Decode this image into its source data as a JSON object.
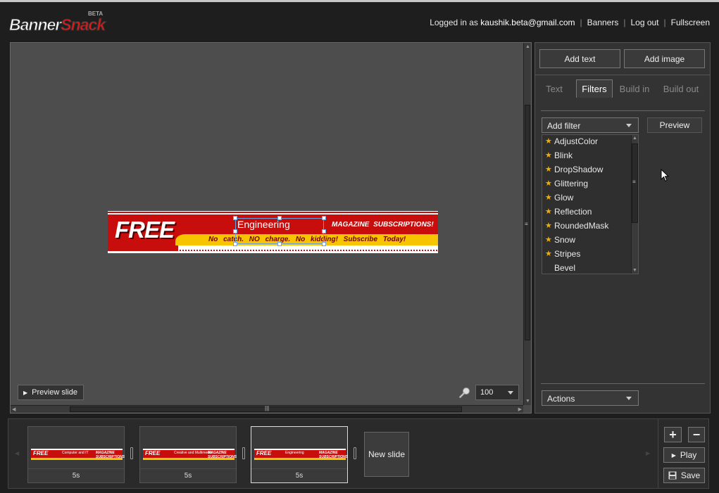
{
  "header": {
    "logo": {
      "part1": "Banner",
      "part2": "Snack",
      "beta": "BETA"
    },
    "logged_prefix": "Logged in as",
    "user_email": "kaushik.beta@gmail.com",
    "links": [
      "Banners",
      "Log out",
      "Fullscreen"
    ],
    "separator": "|"
  },
  "stage": {
    "banner": {
      "free": "FREE",
      "headline": "Engineering",
      "magazine": "MAGAZINE SUBSCRIPTIONS!",
      "subline": "No catch. NO charge. No kidding! Subscribe Today!"
    },
    "preview_slide_label": "Preview slide",
    "zoom_value": "100"
  },
  "right_panel": {
    "add_text_label": "Add text",
    "add_image_label": "Add image",
    "tabs": [
      "Text",
      "Filters",
      "Build in",
      "Build out"
    ],
    "active_tab": "Filters",
    "add_filter_label": "Add filter",
    "preview_label": "Preview",
    "filters": [
      {
        "name": "AdjustColor",
        "starred": true
      },
      {
        "name": "Blink",
        "starred": true
      },
      {
        "name": "DropShadow",
        "starred": true
      },
      {
        "name": "Glittering",
        "starred": true
      },
      {
        "name": "Glow",
        "starred": true
      },
      {
        "name": "Reflection",
        "starred": true
      },
      {
        "name": "RoundedMask",
        "starred": true
      },
      {
        "name": "Snow",
        "starred": true
      },
      {
        "name": "Stripes",
        "starred": true
      },
      {
        "name": "Bevel",
        "starred": false
      }
    ],
    "actions_label": "Actions"
  },
  "timeline": {
    "slides": [
      {
        "duration": "5s",
        "thumb_free": "FREE",
        "thumb_title": "Computer and IT",
        "thumb_mag": "MAGAZINE SUBSCRIPTIONS"
      },
      {
        "duration": "5s",
        "thumb_free": "FREE",
        "thumb_title": "Creative and Multimedia",
        "thumb_mag": "MAGAZINE SUBSCRIPTIONS"
      },
      {
        "duration": "5s",
        "thumb_free": "FREE",
        "thumb_title": "Engineering",
        "thumb_mag": "MAGAZINE SUBSCRIPTIONS"
      }
    ],
    "active_slide": 2,
    "new_slide_label": "New slide"
  },
  "controls": {
    "plus_label": "+",
    "minus_label": "−",
    "play_label": "Play",
    "save_label": "Save"
  },
  "colors": {
    "banner_red": "#c80d0d",
    "banner_yellow": "#f7c400",
    "star": "#f0b000",
    "selection": "#6aa2e0"
  }
}
